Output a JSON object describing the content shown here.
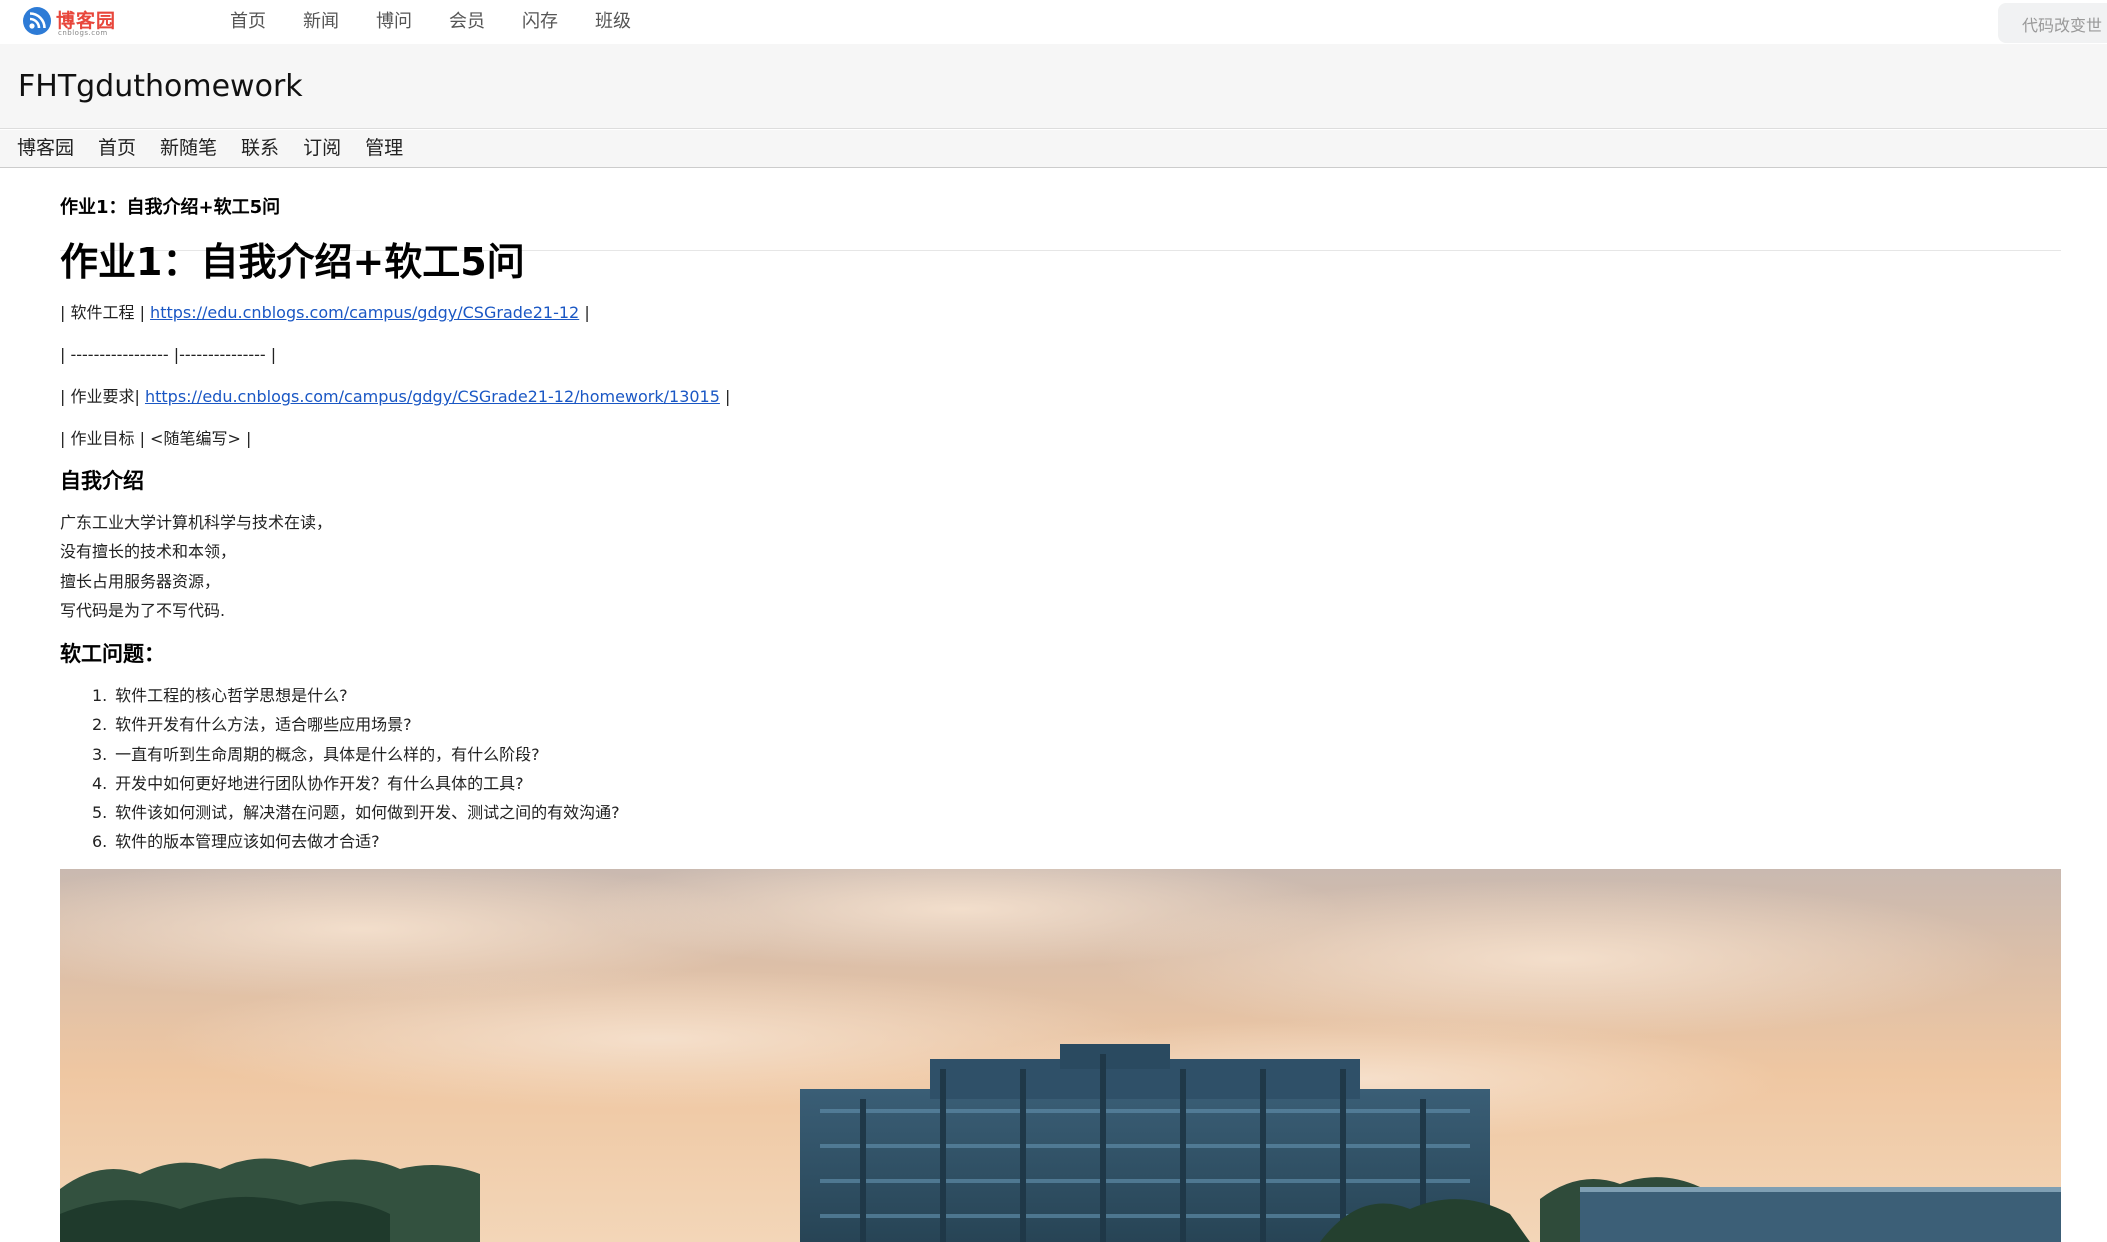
{
  "topnav": {
    "logo": {
      "text": "博客园",
      "sub": "cnblogs.com",
      "icon": "rss-icon"
    },
    "links": [
      "首页",
      "新闻",
      "博问",
      "会员",
      "闪存",
      "班级"
    ],
    "search_placeholder": "代码改变世"
  },
  "blog": {
    "title": "FHTgduthomework",
    "nav": [
      "博客园",
      "首页",
      "新随笔",
      "联系",
      "订阅",
      "管理"
    ]
  },
  "post": {
    "crumb": "作业1：自我介绍+软工5问",
    "title": "作业1：自我介绍+软工5问",
    "line1": {
      "prefix": "| 软件工程 | ",
      "link": "https://edu.cnblogs.com/campus/gdgy/CSGrade21-12",
      "suffix": " |"
    },
    "line2": "| ----------------- |--------------- |",
    "line3": {
      "prefix": "| 作业要求| ",
      "link": "https://edu.cnblogs.com/campus/gdgy/CSGrade21-12/homework/13015",
      "suffix": " |"
    },
    "line4": "| 作业目标 | <随笔编写> |",
    "intro_heading": "自我介绍",
    "intro_lines": [
      "广东工业大学计算机科学与技术在读，",
      "没有擅长的技术和本领，",
      "擅长占用服务器资源，",
      "写代码是为了不写代码."
    ],
    "questions_heading": "软工问题：",
    "questions": [
      "软件工程的核心哲学思想是什么?",
      "软件开发有什么方法，适合哪些应用场景?",
      "一直有听到生命周期的概念，具体是什么样的，有什么阶段?",
      "开发中如何更好地进行团队协作开发？有什么具体的工具?",
      "软件该如何测试，解决潜在问题，如何做到开发、测试之间的有效沟通?",
      "软件的版本管理应该如何去做才合适?"
    ]
  },
  "colors": {
    "link": "#1a57c4",
    "logo_red": "#e8463b",
    "logo_blue": "#2d7bd6",
    "header_bg": "#f6f6f6"
  }
}
